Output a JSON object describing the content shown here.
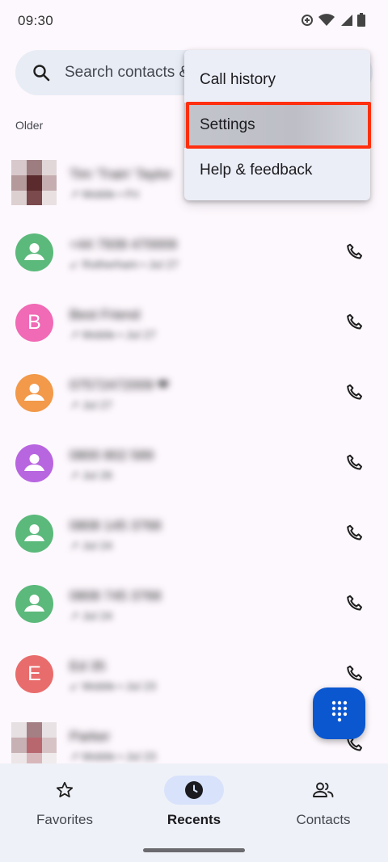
{
  "status_bar": {
    "time": "09:30"
  },
  "search": {
    "placeholder": "Search contacts &"
  },
  "section_header": "Older",
  "calls": [
    {
      "name": "Tim 'Train' Taylor",
      "detail": "↗ Mobile • Fri",
      "avatar_type": "photo"
    },
    {
      "name": "+44 7939 470009",
      "detail": "↙ Rotherham • Jul 27",
      "avatar_type": "icon",
      "avatar_color": "#5bb97b"
    },
    {
      "name": "Best Friend",
      "detail": "↗ Mobile • Jul 27",
      "avatar_type": "letter",
      "avatar_letter": "B",
      "avatar_color": "#f06ab5"
    },
    {
      "name": "07572472009 ❤",
      "detail": "↗ Jul 27",
      "avatar_type": "icon",
      "avatar_color": "#f2994a"
    },
    {
      "name": "0800 802 589",
      "detail": "↗ Jul 26",
      "avatar_type": "icon",
      "avatar_color": "#b865e0"
    },
    {
      "name": "0808 145 3768",
      "detail": "↗ Jul 24",
      "avatar_type": "icon",
      "avatar_color": "#5bb97b"
    },
    {
      "name": "0808 745 3768",
      "detail": "↗ Jul 24",
      "avatar_type": "icon",
      "avatar_color": "#5bb97b"
    },
    {
      "name": "Ed 35",
      "detail": "↙ Mobile • Jul 23",
      "avatar_type": "letter",
      "avatar_letter": "E",
      "avatar_color": "#e96c6c"
    },
    {
      "name": "Parker",
      "detail": "↗ Mobile • Jul 23",
      "avatar_type": "photo"
    }
  ],
  "menu": {
    "items": [
      {
        "label": "Call history"
      },
      {
        "label": "Settings"
      },
      {
        "label": "Help & feedback"
      }
    ]
  },
  "nav": {
    "favorites": "Favorites",
    "recents": "Recents",
    "contacts": "Contacts"
  },
  "colors": {
    "accent": "#0b57d0",
    "highlight": "#ff2f0f"
  }
}
